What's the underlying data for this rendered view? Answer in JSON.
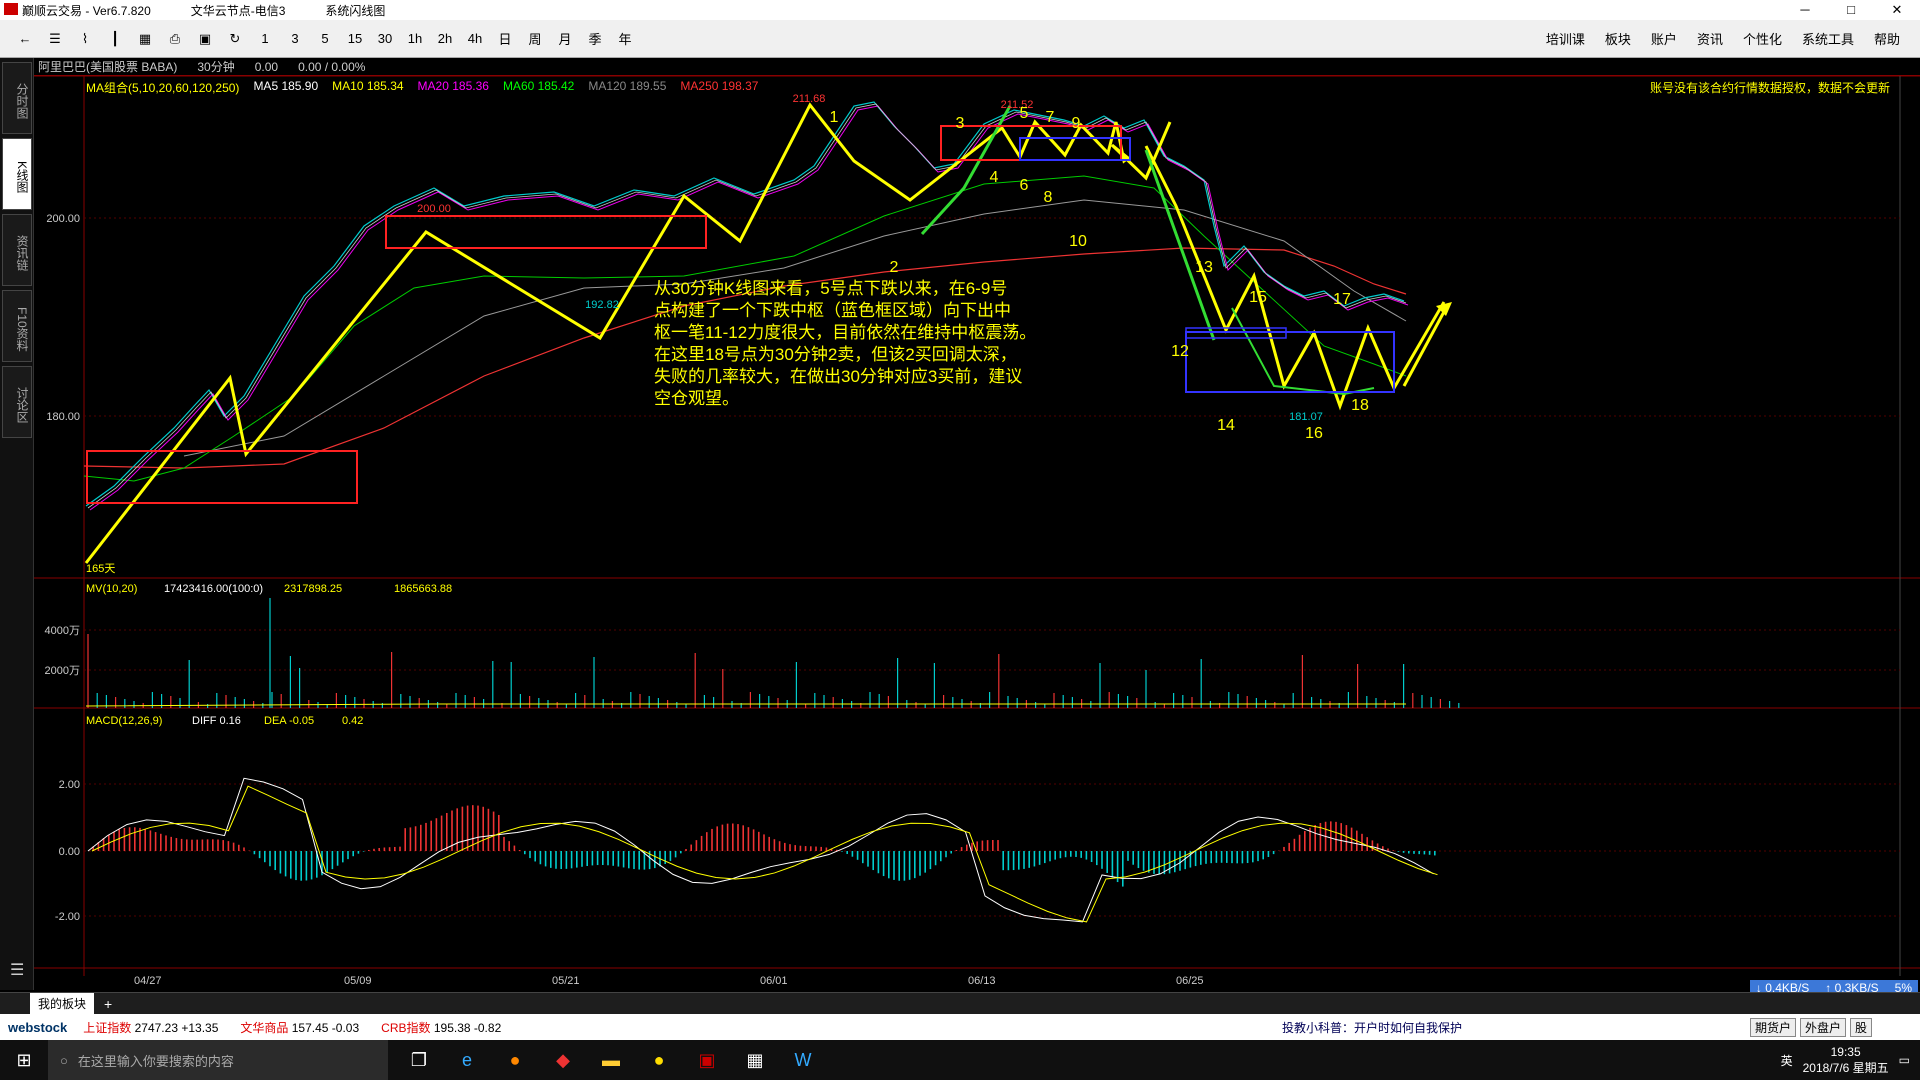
{
  "window": {
    "app_name": "巅顺云交易",
    "version": "Ver6.7.820",
    "server": "文华云节点-电信3",
    "mode": "系统闪线图",
    "controls": [
      "─",
      "□",
      "✕"
    ]
  },
  "toolbar": {
    "periods": [
      "1",
      "3",
      "5",
      "15",
      "30",
      "1h",
      "2h",
      "4h",
      "日",
      "周",
      "月",
      "季",
      "年"
    ],
    "right_menu": [
      "培训课",
      "板块",
      "账户",
      "资讯",
      "个性化",
      "系统工具",
      "帮助"
    ]
  },
  "left_tabs": [
    "分时图",
    "K线图",
    "资讯链",
    "F10资料",
    "讨论区"
  ],
  "info_bar": {
    "symbol": "阿里巴巴(美国股票 BABA)",
    "period": "30分钟",
    "v1": "0.00",
    "v2": "0.00 / 0.00%"
  },
  "ma_line": [
    {
      "label": "MA组合(5,10,20,60,120,250)",
      "color": "#ffff00"
    },
    {
      "label": "MA5 185.90",
      "color": "#ffffff"
    },
    {
      "label": "MA10 185.34",
      "color": "#ffff00"
    },
    {
      "label": "MA20 185.36",
      "color": "#ff00ff"
    },
    {
      "label": "MA60 185.42",
      "color": "#00ff00"
    },
    {
      "label": "MA120 189.55",
      "color": "#888888"
    },
    {
      "label": "MA250 198.37",
      "color": "#ff3333"
    }
  ],
  "notice": "账号没有该合约行情数据授权，数据不会更新",
  "price_axis": [
    "200.00",
    "180.00"
  ],
  "vol_axis": [
    "4000万",
    "2000万"
  ],
  "macd_axis": [
    "2.00",
    "0.00",
    "-2.00"
  ],
  "vol_header": [
    "MV(10,20)",
    "17423416.00(100:0)",
    "2317898.25",
    "1865663.88"
  ],
  "macd_header": [
    "MACD(12,26,9)",
    "DIFF 0.16",
    "DEA -0.05",
    "0.42"
  ],
  "dates": [
    "04/27",
    "05/09",
    "05/21",
    "06/01",
    "06/13",
    "06/25"
  ],
  "price_labels": [
    "211.68",
    "211.52",
    "200.00",
    "192.82",
    "181.07",
    "165天"
  ],
  "wave_numbers": [
    "1",
    "2",
    "3",
    "4",
    "5",
    "6",
    "7",
    "8",
    "9",
    "10",
    "12",
    "13",
    "14",
    "15",
    "16",
    "17",
    "18"
  ],
  "annotation": [
    "从30分钟K线图来看，5号点下跌以来，在6-9号",
    "点构建了一个下跌中枢（蓝色框区域）向下出中",
    "枢一笔11-12力度很大，目前依然在维持中枢震荡。",
    "在这里18号点为30分钟2卖，但该2买回调太深，",
    "失败的几率较大，在做出30分钟对应3买前，建议",
    "空仓观望。"
  ],
  "bottom_tab": "我的板块",
  "ticker": {
    "brand": "webstock",
    "items": [
      {
        "name": "上证指数",
        "value": "2747.23",
        "change": "+13.35"
      },
      {
        "name": "文华商品",
        "value": "157.45",
        "change": "-0.03"
      },
      {
        "name": "CRB指数",
        "value": "195.38",
        "change": "-0.82"
      }
    ],
    "tip": "投教小科普：开户时如何自我保护",
    "buttons": [
      "期货户",
      "外盘户",
      "股"
    ]
  },
  "net": {
    "down": "0.4KB/S",
    "up": "0.3KB/S",
    "pct": "5%"
  },
  "taskbar": {
    "search_placeholder": "在这里输入你要搜索的内容",
    "time": "19:35",
    "date": "2018/7/6 星期五",
    "lang": "英"
  }
}
